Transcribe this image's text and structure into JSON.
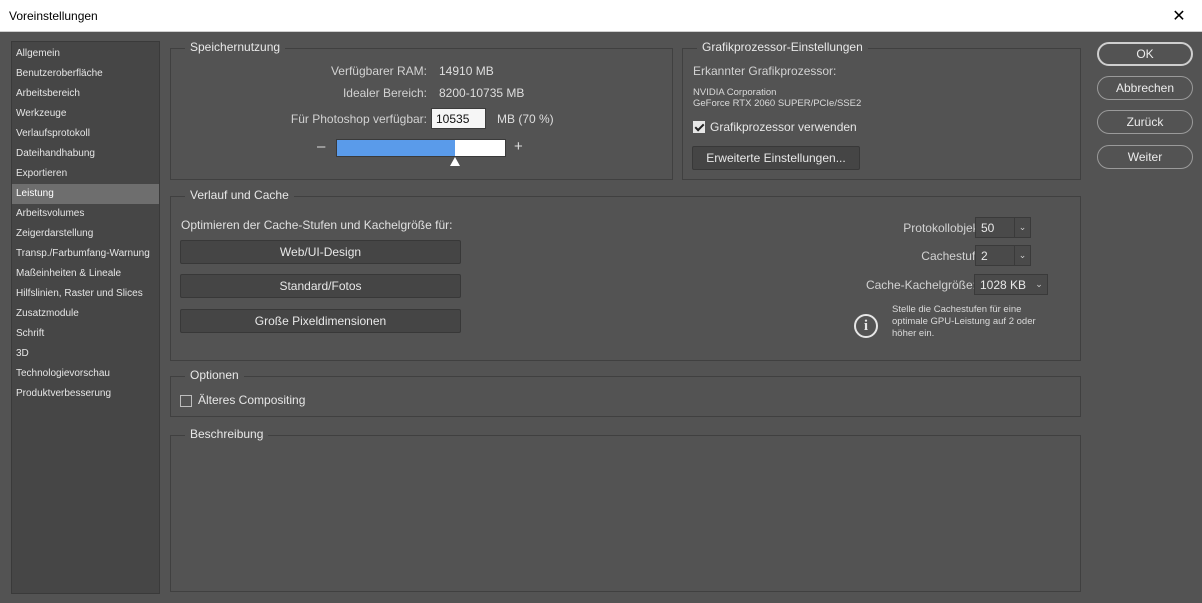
{
  "window": {
    "title": "Voreinstellungen",
    "close_glyph": "✕"
  },
  "sidebar": {
    "items": [
      "Allgemein",
      "Benutzeroberfläche",
      "Arbeitsbereich",
      "Werkzeuge",
      "Verlaufsprotokoll",
      "Dateihandhabung",
      "Exportieren",
      "Leistung",
      "Arbeitsvolumes",
      "Zeigerdarstellung",
      "Transp./Farbumfang-Warnung",
      "Maßeinheiten & Lineale",
      "Hilfslinien, Raster und Slices",
      "Zusatzmodule",
      "Schrift",
      "3D",
      "Technologievorschau",
      "Produktverbesserung"
    ],
    "active": "Leistung"
  },
  "memory": {
    "title": "Speichernutzung",
    "available_label": "Verfügbarer RAM:",
    "available_value": "14910 MB",
    "ideal_label": "Idealer Bereich:",
    "ideal_value": "8200-10735 MB",
    "photoshop_label": "Für Photoshop verfügbar:",
    "photoshop_value": "10535",
    "photoshop_unit": "MB (70 %)",
    "slider_fraction": 0.7,
    "minus": "–",
    "plus": "+"
  },
  "gpu": {
    "title": "Grafikprozessor-Einstellungen",
    "detected_label": "Erkannter Grafikprozessor:",
    "vendor": "NVIDIA Corporation",
    "model": "GeForce RTX 2060 SUPER/PCIe/SSE2",
    "use_gpu_label": "Grafikprozessor verwenden",
    "use_gpu_checked": true,
    "advanced_button": "Erweiterte Einstellungen..."
  },
  "cache": {
    "title": "Verlauf und Cache",
    "optimize_label": "Optimieren der Cache-Stufen und Kachelgröße für:",
    "btn_web": "Web/UI-Design",
    "btn_standard": "Standard/Fotos",
    "btn_large": "Große Pixeldimensionen",
    "history_label": "Protokollobjekte:",
    "history_value": "50",
    "levels_label": "Cachestufen:",
    "levels_value": "2",
    "tile_label": "Cache-Kachelgröße:",
    "tile_value": "1028 KB",
    "hint": "Stelle die Cachestufen für eine optimale GPU-Leistung auf 2 oder höher ein."
  },
  "options": {
    "title": "Optionen",
    "legacy_label": "Älteres Compositing",
    "legacy_checked": false
  },
  "description": {
    "title": "Beschreibung"
  },
  "buttons": {
    "ok": "OK",
    "cancel": "Abbrechen",
    "back": "Zurück",
    "next": "Weiter"
  },
  "colors": {
    "accent": "#5a9bea",
    "panel": "#535353",
    "sidebar": "#464646"
  }
}
